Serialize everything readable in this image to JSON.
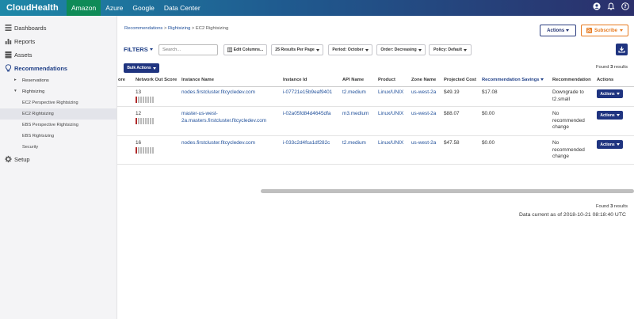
{
  "topbar": {
    "brand": "CloudHealth",
    "tabs": [
      {
        "label": "Amazon",
        "active": true
      },
      {
        "label": "Azure",
        "active": false
      },
      {
        "label": "Google",
        "active": false
      },
      {
        "label": "Data Center",
        "active": false
      }
    ],
    "icons": [
      "user-icon",
      "bell-icon",
      "help-icon"
    ]
  },
  "sidebar": {
    "dashboards": "Dashboards",
    "reports": "Reports",
    "assets": "Assets",
    "recommendations": "Recommendations",
    "reservations": "Reservations",
    "rightsizing": "Rightsizing",
    "ec2_perspective": "EC2 Perspective Rightsizing",
    "ec2_rightsizing": "EC2 Rightsizing",
    "ebs_perspective": "EBS Perspective Rightsizing",
    "ebs_rightsizing": "EBS Rightsizing",
    "security": "Security",
    "setup": "Setup"
  },
  "breadcrumb": {
    "recommendations": "Recommendations",
    "rightsizing": "Rightsizing",
    "current": "EC2 Rightsizing",
    "sep": " > "
  },
  "header": {
    "actions_label": "Actions",
    "subscribe_label": "Subscribe"
  },
  "filters": {
    "label": "FILTERS",
    "search_placeholder": "Search...",
    "edit_columns": "Edit Columns...",
    "results_per_page": "25 Results Per Page",
    "period": "Period: October",
    "order": "Order: Decreasing",
    "policy": "Policy: Default"
  },
  "bulk_actions": "Bulk Actions",
  "found_prefix": "Found ",
  "found_count": "3",
  "found_suffix": " results",
  "table": {
    "columns": {
      "score": "ore",
      "network": "Network Out Score",
      "instance_name": "Instance Name",
      "instance_id": "Instance Id",
      "api_name": "API Name",
      "product": "Product",
      "zone": "Zone Name",
      "projected_cost": "Projected Cost",
      "savings": "Recommendation Savings",
      "recommendation": "Recommendation",
      "actions": "Actions"
    },
    "rows": [
      {
        "network_score": "13",
        "score_fill": 1,
        "instance_name": "nodes.firstcluster.fitcycledev.com",
        "instance_id": "i-07721e15b9eaf9401",
        "api_name": "t2.medium",
        "product": "Linux/UNIX",
        "zone": "us-west-2a",
        "projected_cost": "$49.19",
        "savings": "$17.08",
        "recommendation": "Downgrade to t2.small",
        "action": "Actions"
      },
      {
        "network_score": "12",
        "score_fill": 1,
        "instance_name": "master-us-west-2a.masters.firstcluster.fitcycledev.com",
        "instance_id": "i-02a05fd84d4645dfa",
        "api_name": "m3.medium",
        "product": "Linux/UNIX",
        "zone": "us-west-2a",
        "projected_cost": "$88.07",
        "savings": "$0.00",
        "recommendation": "No recommended change",
        "action": "Actions"
      },
      {
        "network_score": "16",
        "score_fill": 1,
        "instance_name": "nodes.firstcluster.fitcycledev.com",
        "instance_id": "i-033c2d4fca1df282c",
        "api_name": "t2.medium",
        "product": "Linux/UNIX",
        "zone": "us-west-2a",
        "projected_cost": "$47.58",
        "savings": "$0.00",
        "recommendation": "No recommended change",
        "action": "Actions"
      }
    ]
  },
  "data_current": "Data current as of 2018-10-21 08:18:40 UTC",
  "colors": {
    "accent": "#1f3480",
    "active_tab": "#0f8b57",
    "subscribe": "#e77a1f",
    "score_fill": "#b12a2a"
  }
}
